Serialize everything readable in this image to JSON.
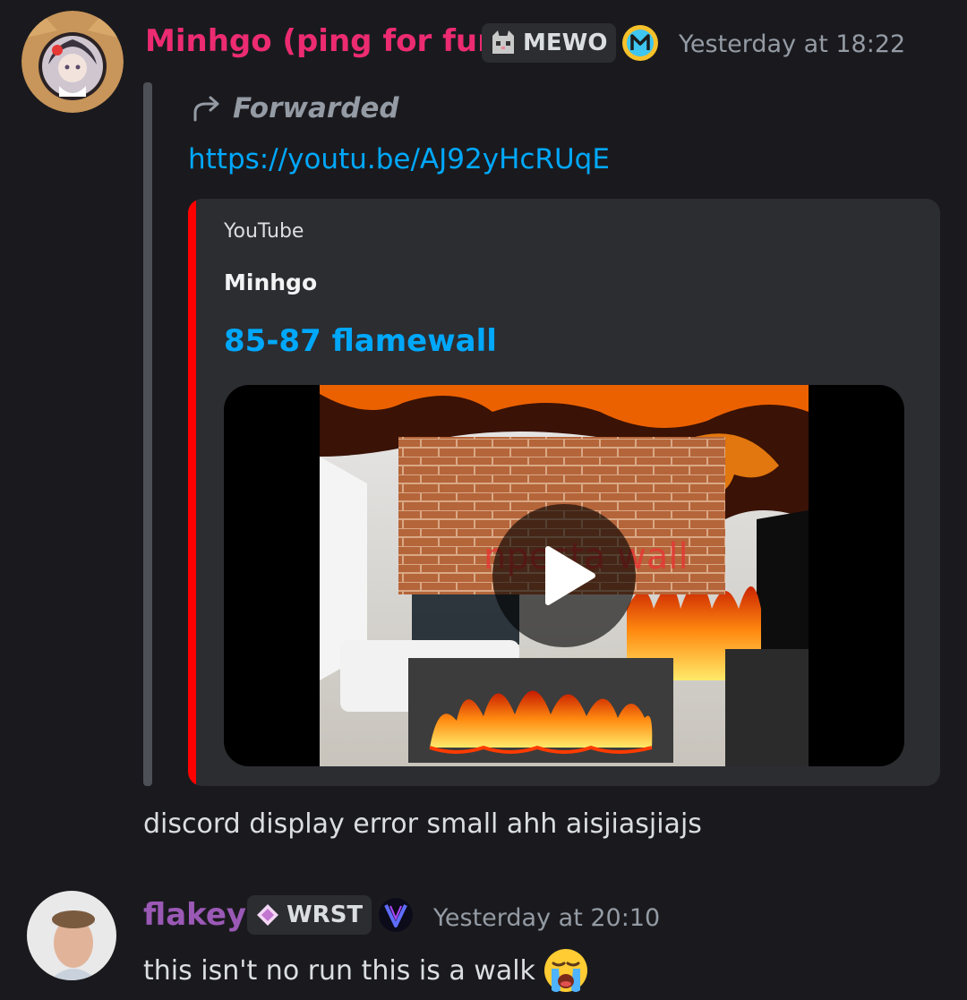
{
  "messages": [
    {
      "author": "Minhgo (ping for fun)",
      "author_color": "#ec2b71",
      "tag": "MEWO",
      "badge_icon": "yellow-m-badge-icon",
      "timestamp": "Yesterday at 18:22",
      "forwarded_label": "Forwarded",
      "link": "https://youtu.be/AJ92yHcRUqE",
      "embed": {
        "provider": "YouTube",
        "author": "Minhgo",
        "title": "85-87 flamewall",
        "accent": "#ff0000",
        "thumbnail_overlay_text": "npesta wall"
      },
      "body": "discord display error small ahh aisjiasjiajs"
    },
    {
      "author": "flakey",
      "author_color": "#9b59b6",
      "tag": "WRST",
      "badge_icon": "dark-v-badge-icon",
      "timestamp": "Yesterday at 20:10",
      "body": "this isn't no run this is a walk",
      "emoji": "😭"
    }
  ]
}
